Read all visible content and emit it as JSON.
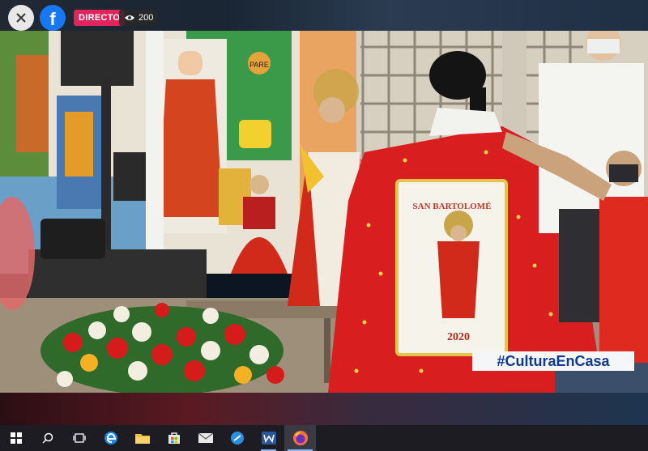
{
  "overlay": {
    "live_label": "DIRECTO",
    "viewer_count": "200",
    "hashtag": "#CulturaEnCasa"
  },
  "video": {
    "banner_title": "SAN BARTOLOMÉ",
    "banner_year": "2020",
    "sign_text": "PARE"
  },
  "icons": {
    "close": "close-icon",
    "facebook": "facebook-icon",
    "viewers": "eye-icon"
  },
  "taskbar": {
    "items": [
      "start",
      "search",
      "task-view",
      "edge",
      "file-explorer",
      "store",
      "mail",
      "app",
      "word",
      "firefox"
    ],
    "active": "firefox"
  },
  "colors": {
    "live_red": "#e0245e",
    "facebook_blue": "#1877f2",
    "hashtag_text": "#0f3a8f",
    "cape_red": "#d81e1e"
  }
}
